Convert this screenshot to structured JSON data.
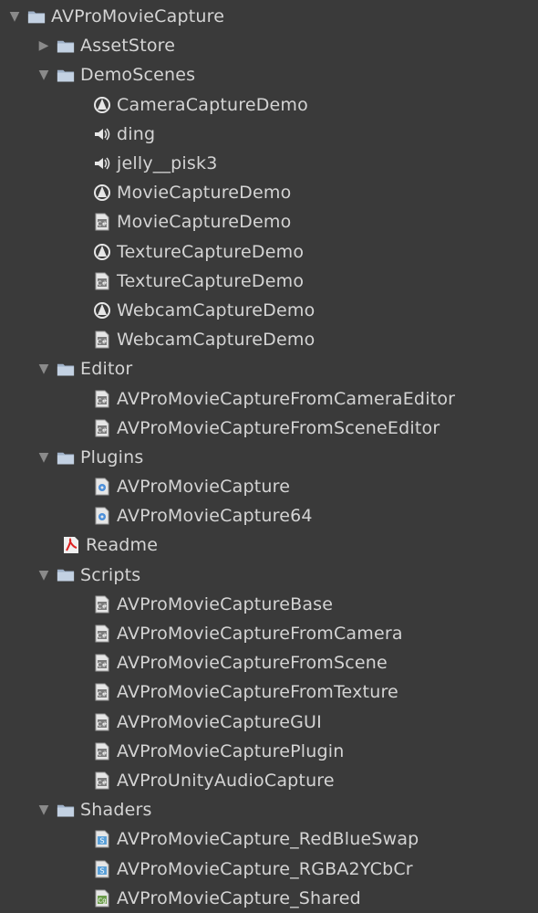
{
  "tree": {
    "root": {
      "label": "AVProMovieCapture",
      "icon": "folder-icon"
    },
    "items": [
      {
        "label": "AssetStore",
        "icon": "folder-icon",
        "depth": 1,
        "arrow": "collapsed"
      },
      {
        "label": "DemoScenes",
        "icon": "folder-icon",
        "depth": 1,
        "arrow": "expanded"
      },
      {
        "label": "CameraCaptureDemo",
        "icon": "unity-scene-icon",
        "depth": 2
      },
      {
        "label": "ding",
        "icon": "audio-icon",
        "depth": 2
      },
      {
        "label": "jelly__pisk3",
        "icon": "audio-icon",
        "depth": 2
      },
      {
        "label": "MovieCaptureDemo",
        "icon": "unity-scene-icon",
        "depth": 2
      },
      {
        "label": "MovieCaptureDemo",
        "icon": "csharp-script-icon",
        "depth": 2
      },
      {
        "label": "TextureCaptureDemo",
        "icon": "unity-scene-icon",
        "depth": 2
      },
      {
        "label": "TextureCaptureDemo",
        "icon": "csharp-script-icon",
        "depth": 2
      },
      {
        "label": "WebcamCaptureDemo",
        "icon": "unity-scene-icon",
        "depth": 2
      },
      {
        "label": "WebcamCaptureDemo",
        "icon": "csharp-script-icon",
        "depth": 2
      },
      {
        "label": "Editor",
        "icon": "folder-icon",
        "depth": 1,
        "arrow": "expanded"
      },
      {
        "label": "AVProMovieCaptureFromCameraEditor",
        "icon": "csharp-script-icon",
        "depth": 2
      },
      {
        "label": "AVProMovieCaptureFromSceneEditor",
        "icon": "csharp-script-icon",
        "depth": 2
      },
      {
        "label": "Plugins",
        "icon": "folder-icon",
        "depth": 1,
        "arrow": "expanded"
      },
      {
        "label": "AVProMovieCapture",
        "icon": "plugin-dll-icon",
        "depth": 2
      },
      {
        "label": "AVProMovieCapture64",
        "icon": "plugin-dll-icon",
        "depth": 2
      },
      {
        "label": "Readme",
        "icon": "pdf-icon",
        "depth": 1
      },
      {
        "label": "Scripts",
        "icon": "folder-icon",
        "depth": 1,
        "arrow": "expanded"
      },
      {
        "label": "AVProMovieCaptureBase",
        "icon": "csharp-script-icon",
        "depth": 2
      },
      {
        "label": "AVProMovieCaptureFromCamera",
        "icon": "csharp-script-icon",
        "depth": 2
      },
      {
        "label": "AVProMovieCaptureFromScene",
        "icon": "csharp-script-icon",
        "depth": 2
      },
      {
        "label": "AVProMovieCaptureFromTexture",
        "icon": "csharp-script-icon",
        "depth": 2
      },
      {
        "label": "AVProMovieCaptureGUI",
        "icon": "csharp-script-icon",
        "depth": 2
      },
      {
        "label": "AVProMovieCapturePlugin",
        "icon": "csharp-script-icon",
        "depth": 2
      },
      {
        "label": "AVProUnityAudioCapture",
        "icon": "csharp-script-icon",
        "depth": 2
      },
      {
        "label": "Shaders",
        "icon": "folder-icon",
        "depth": 1,
        "arrow": "expanded"
      },
      {
        "label": "AVProMovieCapture_RedBlueSwap",
        "icon": "shader-icon",
        "depth": 2
      },
      {
        "label": "AVProMovieCapture_RGBA2YCbCr",
        "icon": "shader-icon",
        "depth": 2
      },
      {
        "label": "AVProMovieCapture_Shared",
        "icon": "cg-include-icon",
        "depth": 2
      }
    ]
  },
  "colors": {
    "background": "#3a3a3a",
    "text": "#d4d4d4",
    "folder": "#b8c6d8",
    "arrow": "#8a8a8a"
  }
}
